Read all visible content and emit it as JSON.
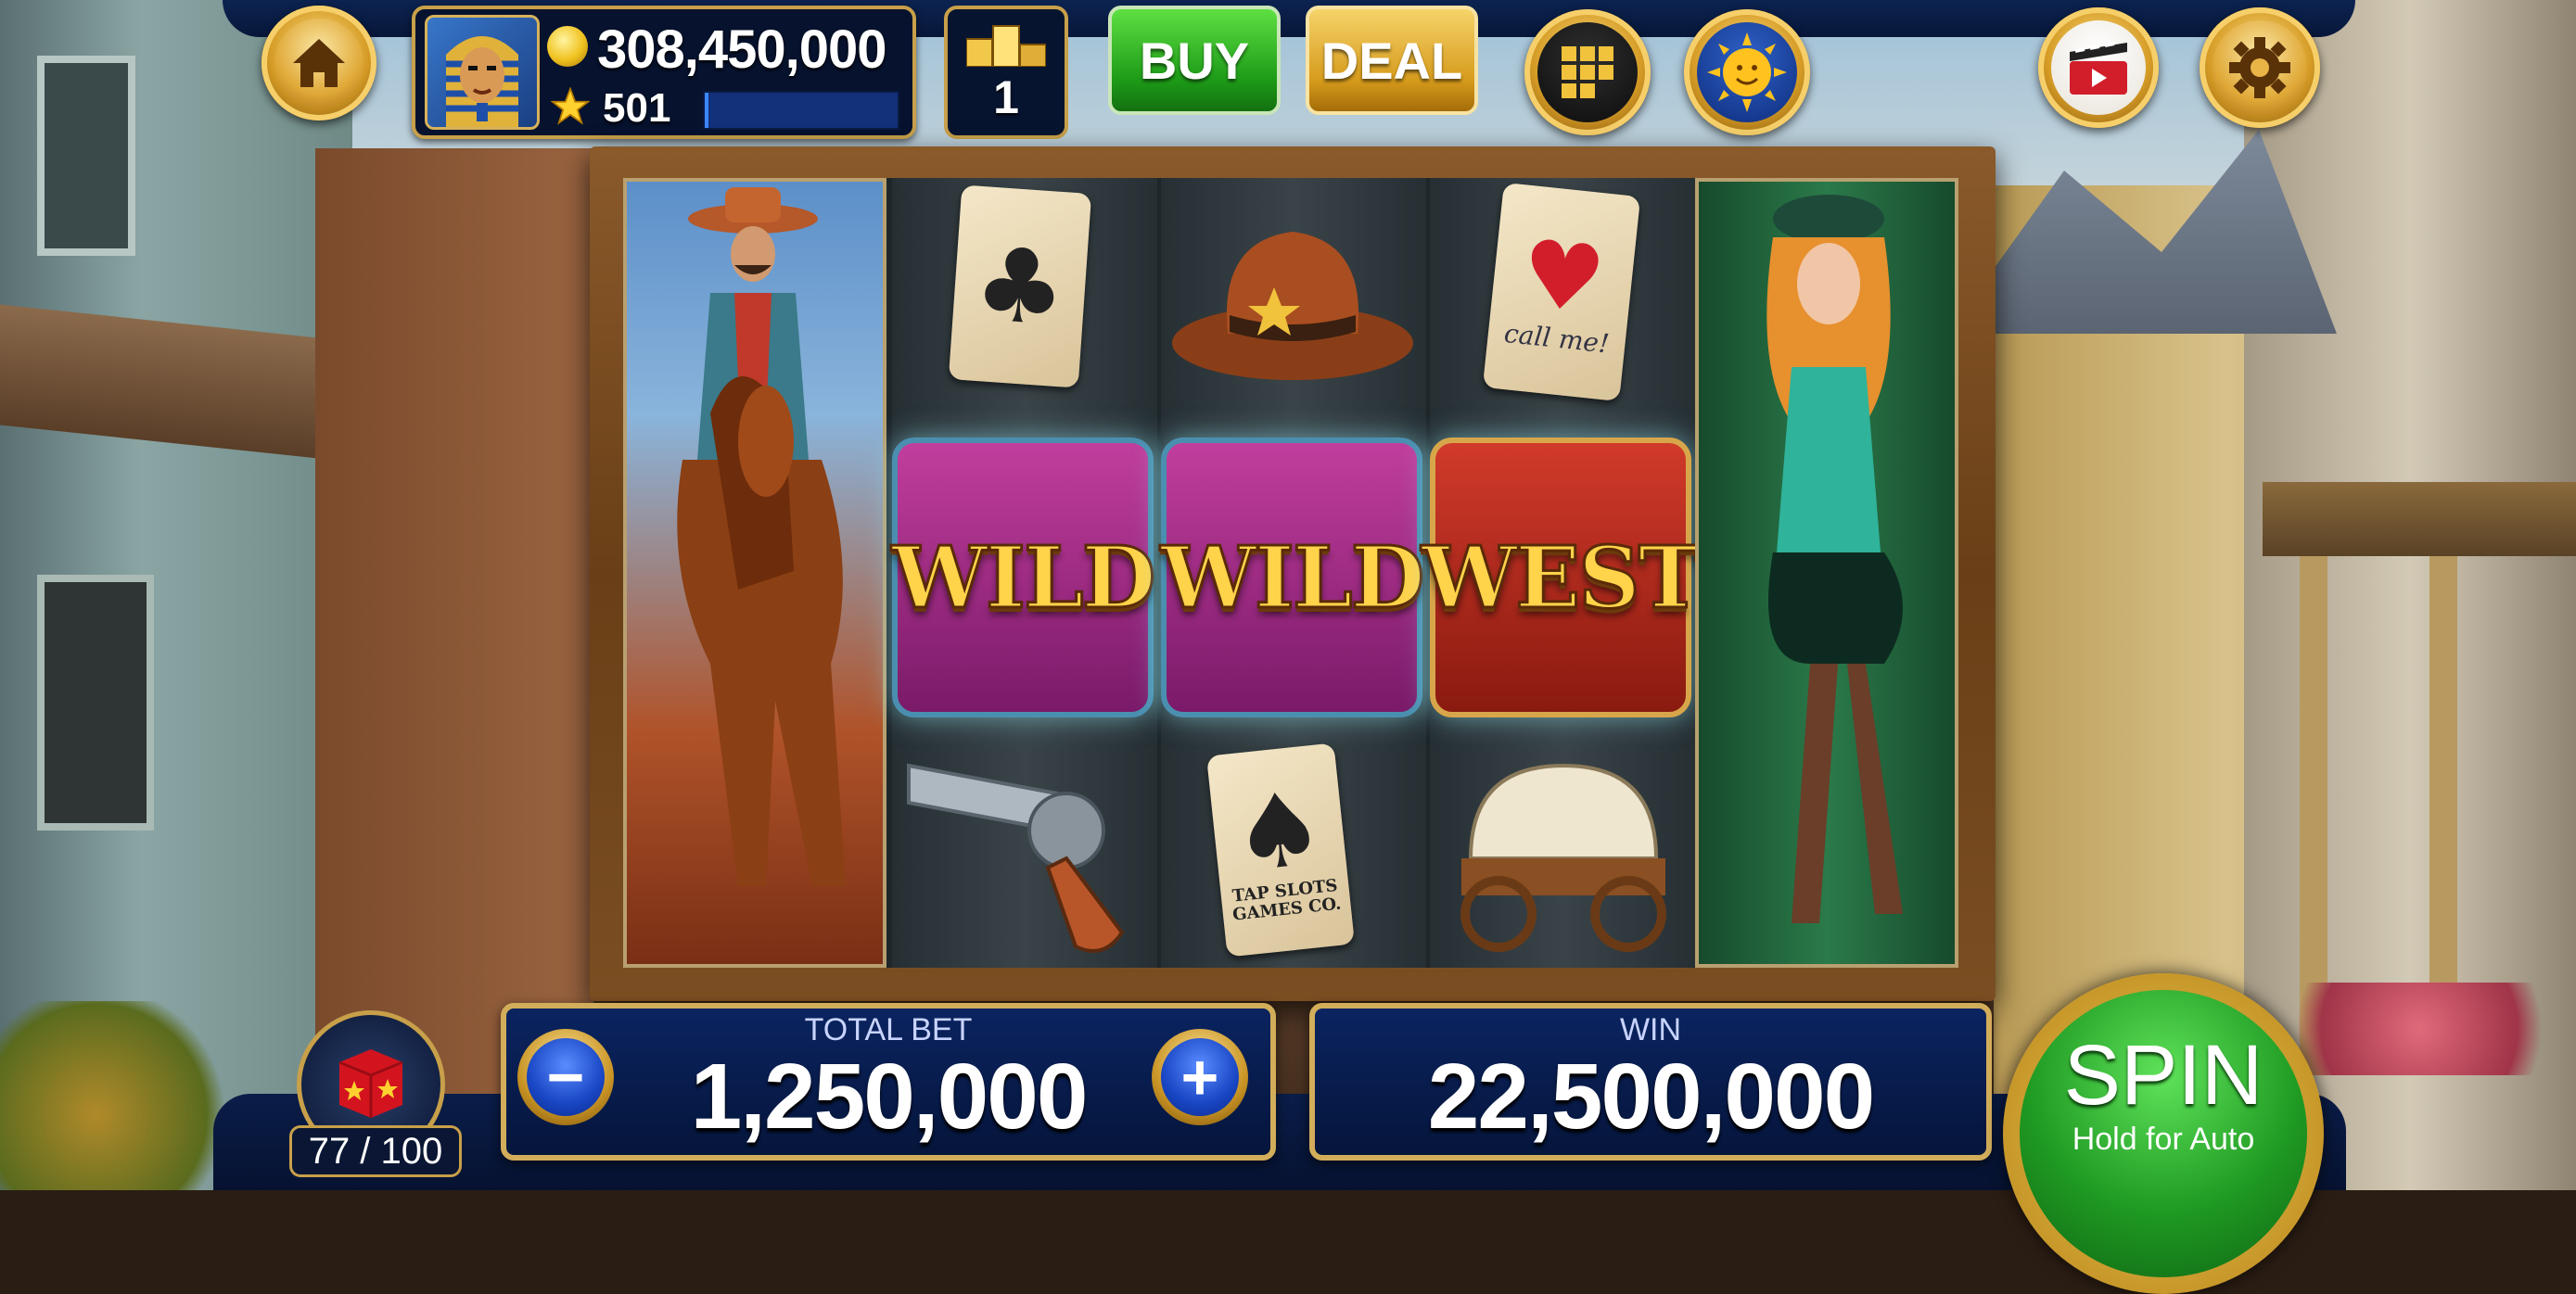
{
  "game": {
    "theme": "Wild Wild West",
    "colors": {
      "accent_gold": "#d2ad5a",
      "panel_blue": "#0b2460",
      "spin_green": "#1f9a22",
      "buy_green": "#1d9a17",
      "deal_gold": "#d69b1c"
    }
  },
  "topbar": {
    "coins": "308,450,000",
    "stars": "501",
    "xp_fill": 0.02,
    "level": "1",
    "buy_label": "BUY",
    "deal_label": "DEAL",
    "icons": [
      "home-icon",
      "coin-icon",
      "star-icon",
      "podium-icon",
      "grid-menu-icon",
      "sun-icon",
      "video-icon",
      "gear-icon"
    ]
  },
  "reels": {
    "columns": [
      {
        "symbols": [
          "cowboy-on-horse"
        ]
      },
      {
        "symbols": [
          "ace-of-clubs",
          "wild",
          "revolver"
        ]
      },
      {
        "symbols": [
          "sheriff-hat",
          "wild",
          "ace-of-spades"
        ]
      },
      {
        "symbols": [
          "hearts-card",
          "west",
          "covered-wagon"
        ]
      },
      {
        "symbols": [
          "saloon-girl"
        ]
      }
    ],
    "card_texts": {
      "call_me": "call me!",
      "tap_slots": "TAP SLOTS GAMES CO."
    },
    "wild_text": "WILD",
    "west_text": "WEST"
  },
  "bottom": {
    "total_bet_label": "TOTAL BET",
    "total_bet_value": "1,250,000",
    "win_label": "WIN",
    "win_value": "22,500,000",
    "gift_count": "77 / 100",
    "spin_label": "SPIN",
    "spin_sub": "Hold for Auto"
  }
}
